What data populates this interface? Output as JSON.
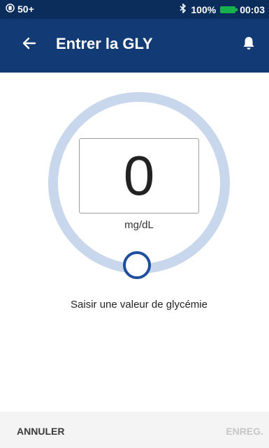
{
  "status_bar": {
    "left_text": "50+",
    "battery_percent": "100%",
    "time": "00:03",
    "icons": [
      "sim-icon",
      "bluetooth-icon",
      "battery-icon"
    ]
  },
  "app_bar": {
    "title": "Entrer la GLY",
    "icons": [
      "back-arrow-icon",
      "bell-icon"
    ]
  },
  "glucose_entry": {
    "value": "0",
    "unit": "mg/dL",
    "slider_level": 0,
    "instruction": "Saisir une valeur de glycémie"
  },
  "actions": {
    "cancel_label": "ANNULER",
    "save_label": "ENREG."
  },
  "colors": {
    "status_bar_bg": "#0b2d5c",
    "app_bar_bg": "#123b75",
    "ring": "#c9d7ec",
    "knob": "#1f4e9c",
    "battery": "#18b04a",
    "save_disabled": "#c6c6c6"
  }
}
